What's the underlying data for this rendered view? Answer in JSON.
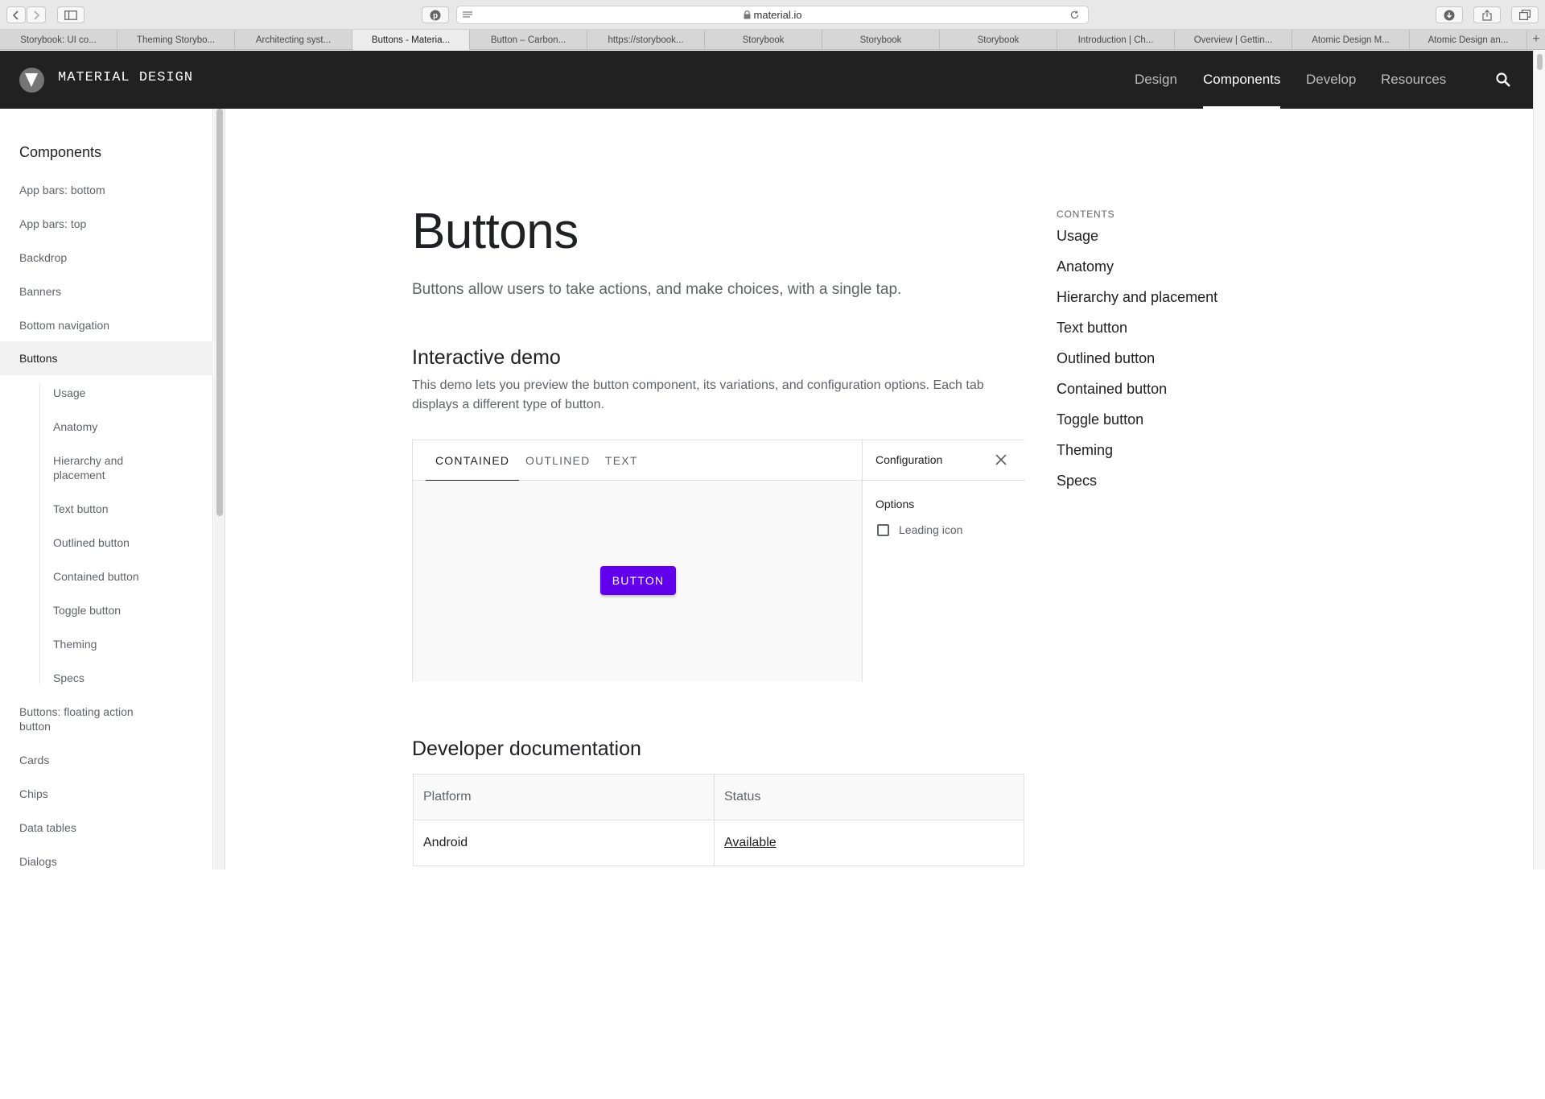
{
  "browser": {
    "url": "material.io",
    "tabs": [
      {
        "label": "Storybook: UI co..."
      },
      {
        "label": "Theming Storybo..."
      },
      {
        "label": "Architecting syst..."
      },
      {
        "label": "Buttons - Materia..."
      },
      {
        "label": "Button – Carbon..."
      },
      {
        "label": "https://storybook..."
      },
      {
        "label": "Storybook"
      },
      {
        "label": "Storybook"
      },
      {
        "label": "Storybook"
      },
      {
        "label": "Introduction | Ch..."
      },
      {
        "label": "Overview | Gettin..."
      },
      {
        "label": "Atomic Design M..."
      },
      {
        "label": "Atomic Design an..."
      }
    ],
    "new_tab": "+"
  },
  "appbar": {
    "brand": "MATERIAL DESIGN",
    "nav": [
      {
        "label": "Design"
      },
      {
        "label": "Components"
      },
      {
        "label": "Develop"
      },
      {
        "label": "Resources"
      }
    ]
  },
  "sidebar": {
    "title": "Components",
    "items_before": [
      {
        "label": "App bars: bottom"
      },
      {
        "label": "App bars: top"
      },
      {
        "label": "Backdrop"
      },
      {
        "label": "Banners"
      },
      {
        "label": "Bottom navigation"
      }
    ],
    "selected": "Buttons",
    "sub_items": [
      {
        "label": "Usage"
      },
      {
        "label": "Anatomy"
      },
      {
        "label": "Hierarchy and\nplacement"
      },
      {
        "label": "Text button"
      },
      {
        "label": "Outlined button"
      },
      {
        "label": "Contained button"
      },
      {
        "label": "Toggle button"
      },
      {
        "label": "Theming"
      },
      {
        "label": "Specs"
      }
    ],
    "items_after": [
      {
        "label": "Buttons: floating action\nbutton"
      },
      {
        "label": "Cards"
      },
      {
        "label": "Chips"
      },
      {
        "label": "Data tables"
      },
      {
        "label": "Dialogs"
      }
    ]
  },
  "main": {
    "title": "Buttons",
    "lead": "Buttons allow users to take actions, and make choices, with a single tap.",
    "demo_heading": "Interactive demo",
    "demo_desc": "This demo lets you preview the button component, its variations, and configuration options. Each tab displays a different type of button.",
    "demo": {
      "tabs": [
        {
          "label": "CONTAINED"
        },
        {
          "label": "OUTLINED"
        },
        {
          "label": "TEXT"
        }
      ],
      "button_label": "BUTTON",
      "button_color": "#6200ee",
      "config_title": "Configuration",
      "options_label": "Options",
      "checkbox_label": "Leading icon"
    },
    "dev_heading": "Developer documentation",
    "table": {
      "headers": [
        "Platform",
        "Status"
      ],
      "rows": [
        {
          "platform": "Android",
          "status": "Available"
        }
      ]
    }
  },
  "contents": {
    "heading": "CONTENTS",
    "items": [
      {
        "label": "Usage"
      },
      {
        "label": "Anatomy"
      },
      {
        "label": "Hierarchy and placement"
      },
      {
        "label": "Text button"
      },
      {
        "label": "Outlined button"
      },
      {
        "label": "Contained button"
      },
      {
        "label": "Toggle button"
      },
      {
        "label": "Theming"
      },
      {
        "label": "Specs"
      }
    ]
  }
}
